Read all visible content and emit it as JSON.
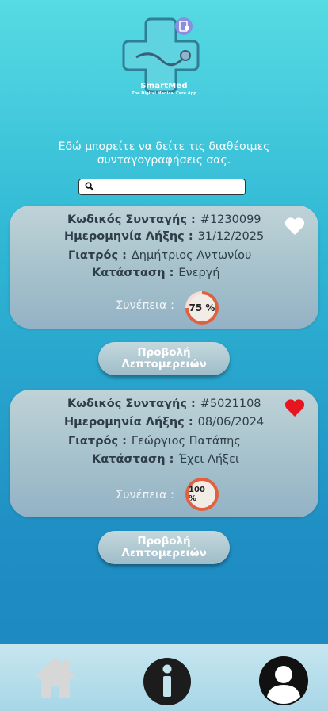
{
  "app": {
    "name": "SmartMed",
    "tagline": "The Digital Medical Care App"
  },
  "intro_text": "Εδώ μπορείτε να δείτε τις διαθέσιμες συνταγογραφήσεις σας.",
  "search": {
    "placeholder": "",
    "value": ""
  },
  "labels": {
    "code": "Κωδικός Συνταγής :",
    "expiry": "Ημερομηνία Λήξης :",
    "doctor": "Γιατρός :",
    "status": "Κατάσταση :",
    "adherence": "Συνέπεια :",
    "details_button": "Προβολή Λεπτομερειών"
  },
  "prescriptions": [
    {
      "code": "#1230099",
      "expiry": "31/12/2025",
      "doctor": "Δημήτριος Αντωνίου",
      "status": "Ενεργή",
      "adherence_label": "75 %",
      "adherence_percent": 75,
      "favorite": false
    },
    {
      "code": "#5021108",
      "expiry": "08/06/2024",
      "doctor": "Γεώργιος Πατάπης",
      "status": "Έχει Λήξει",
      "adherence_label": "100 %",
      "adherence_percent": 100,
      "favorite": true
    }
  ],
  "colors": {
    "ring_progress": "#e0603f",
    "ring_track": "#f3ded6",
    "heart_active": "#e8141f",
    "heart_inactive": "#ffffff"
  },
  "bottom_nav": {
    "home": "home-icon",
    "info": "info-icon",
    "profile": "user-icon"
  }
}
